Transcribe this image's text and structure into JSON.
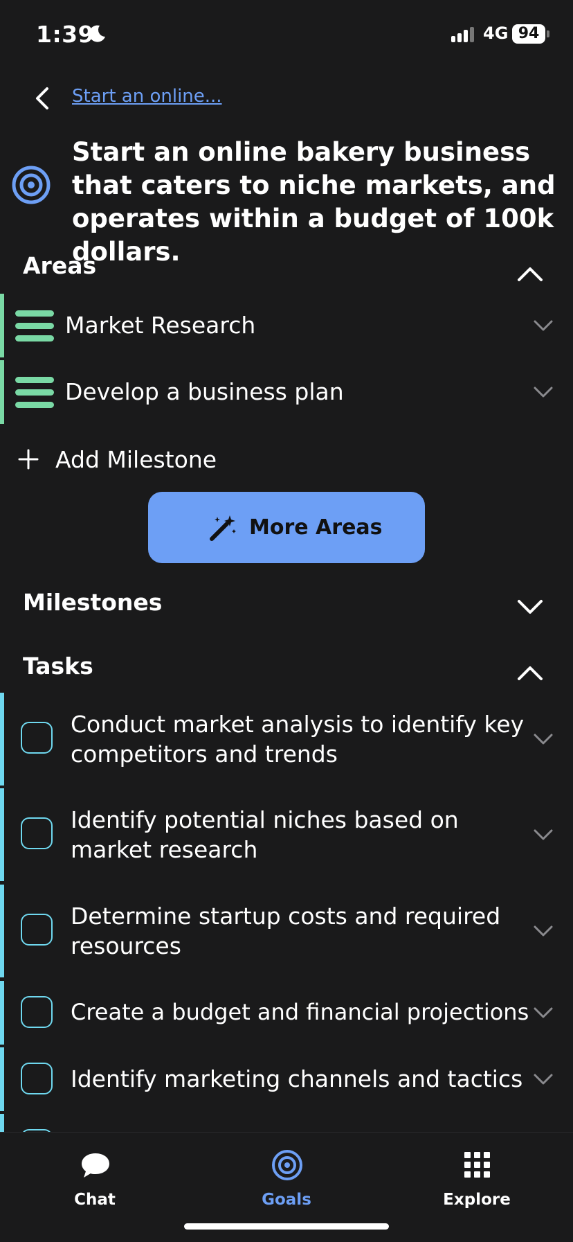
{
  "status_bar": {
    "time": "1:39",
    "network": "4G",
    "battery": "94"
  },
  "header": {
    "breadcrumb": "Start an online..."
  },
  "goal": {
    "title": "Start an online bakery business that caters to niche markets, and operates within a budget of 100k dollars."
  },
  "areas": {
    "header": "Areas",
    "items": [
      {
        "label": "Market Research"
      },
      {
        "label": "Develop a business plan"
      }
    ],
    "add_label": "Add Milestone",
    "more_button": "More Areas"
  },
  "milestones": {
    "header": "Milestones"
  },
  "tasks": {
    "header": "Tasks",
    "items": [
      {
        "label": "Conduct market analysis to identify key competitors and trends"
      },
      {
        "label": "Identify potential niches based on market research"
      },
      {
        "label": "Determine startup costs and required resources"
      },
      {
        "label": "Create a budget and financial projections"
      },
      {
        "label": "Identify marketing channels and tactics"
      }
    ]
  },
  "tab_bar": {
    "tabs": [
      {
        "label": "Chat",
        "icon": "chat-bubble-icon"
      },
      {
        "label": "Goals",
        "icon": "target-icon",
        "active": true
      },
      {
        "label": "Explore",
        "icon": "grid-icon"
      }
    ]
  },
  "colors": {
    "accent": "#6d9ff5",
    "area_green": "#7ad9a5",
    "task_cyan": "#6fd8ef",
    "background": "#1a1a1b"
  }
}
